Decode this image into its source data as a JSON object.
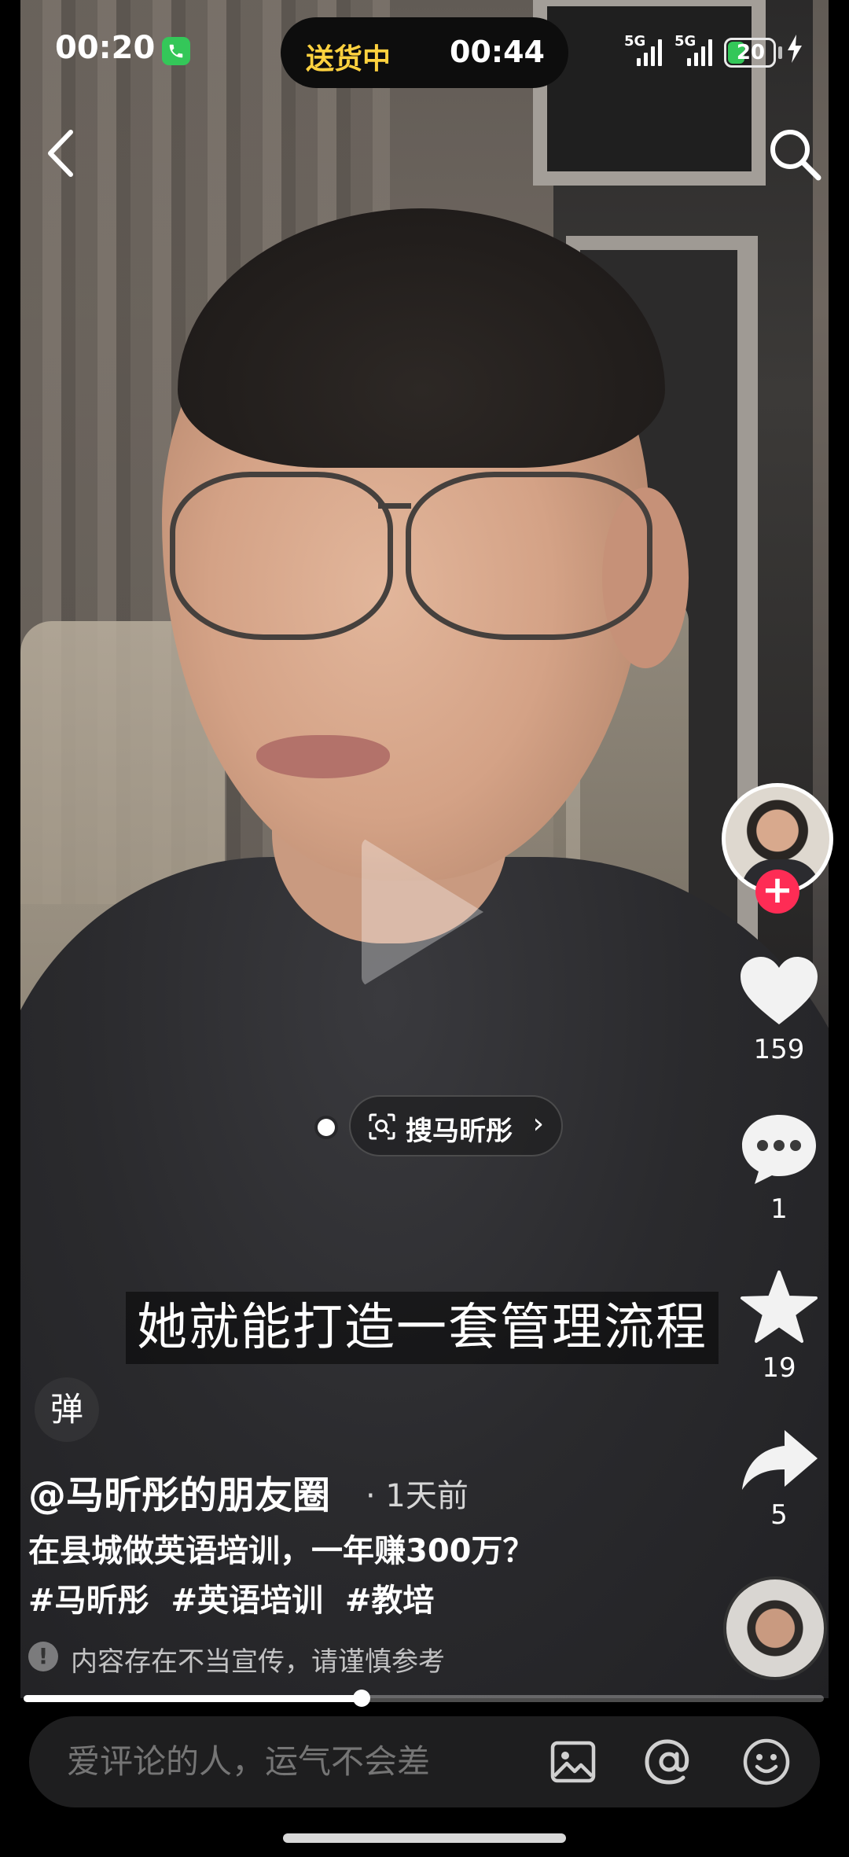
{
  "status_bar": {
    "time": "00:20",
    "call_icon": "phone-icon",
    "island_left": "送货中",
    "island_right": "00:44",
    "signal_1": "5G",
    "signal_2": "5G",
    "battery": "20",
    "battery_level": 0.2,
    "charging_icon": "bolt-icon",
    "battery_color": "#34c759"
  },
  "nav": {
    "back_icon": "chevron-left-icon",
    "search_icon": "search-icon"
  },
  "video": {
    "subtitle": "她就能打造一套管理流程",
    "play_icon": "play-icon",
    "search_chip": {
      "icon": "scan-search-icon",
      "label": "搜马昕彤",
      "chevron": "›"
    }
  },
  "rail": {
    "avatar_icon": "creator-avatar",
    "follow": "+",
    "follow_color": "#fe2c55",
    "likes": "159",
    "comments": "1",
    "favorites": "19",
    "shares": "5"
  },
  "caption": {
    "danmu": "弹",
    "author": "@马昕彤的朋友圈",
    "time_ago": "· 1天前",
    "title": "在县城做英语培训，一年赚300万？",
    "hashtags": [
      "#马昕彤",
      "#英语培训",
      "#教培"
    ],
    "warning": "内容存在不当宣传，请谨慎参考"
  },
  "progress": {
    "fraction": 0.422
  },
  "comment_bar": {
    "placeholder": "爱评论的人，运气不会差",
    "image_icon": "image-icon",
    "mention_icon": "at-icon",
    "emoji_icon": "emoji-icon"
  }
}
